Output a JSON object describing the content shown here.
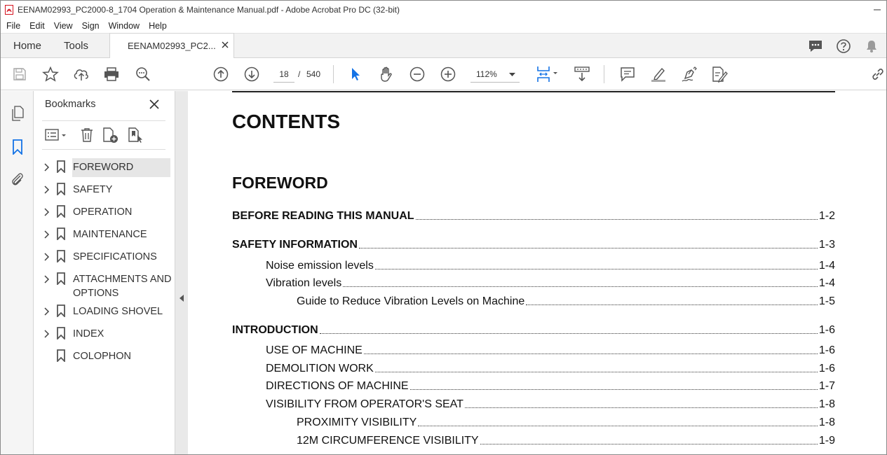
{
  "window": {
    "title": "EENAM02993_PC2000-8_1704 Operation & Maintenance Manual.pdf - Adobe Acrobat Pro DC (32-bit)"
  },
  "menu": [
    "File",
    "Edit",
    "View",
    "Sign",
    "Window",
    "Help"
  ],
  "tabs": {
    "home": "Home",
    "tools": "Tools",
    "document": "EENAM02993_PC2..."
  },
  "toolbar": {
    "current_page": "18",
    "page_separator": "/",
    "total_pages": "540",
    "zoom": "112%"
  },
  "bookmarks": {
    "title": "Bookmarks",
    "items": [
      {
        "label": "FOREWORD",
        "expandable": true,
        "selected": true
      },
      {
        "label": "SAFETY",
        "expandable": true
      },
      {
        "label": "OPERATION",
        "expandable": true
      },
      {
        "label": "MAINTENANCE",
        "expandable": true
      },
      {
        "label": "SPECIFICATIONS",
        "expandable": true
      },
      {
        "label": "ATTACHMENTS AND OPTIONS",
        "expandable": true
      },
      {
        "label": "LOADING SHOVEL",
        "expandable": true
      },
      {
        "label": "INDEX",
        "expandable": true
      },
      {
        "label": "COLOPHON",
        "expandable": false
      }
    ]
  },
  "document": {
    "heading": "CONTENTS",
    "section": "FOREWORD",
    "toc": [
      {
        "title": "BEFORE READING THIS MANUAL",
        "page": "1-2",
        "level": 0
      },
      {
        "title": "SAFETY INFORMATION",
        "page": "1-3",
        "level": 0
      },
      {
        "title": "Noise emission levels",
        "page": "1-4",
        "level": 1
      },
      {
        "title": "Vibration levels",
        "page": "1-4",
        "level": 1
      },
      {
        "title": "Guide to Reduce Vibration Levels on Machine",
        "page": "1-5",
        "level": 2
      },
      {
        "title": "INTRODUCTION",
        "page": "1-6",
        "level": 0
      },
      {
        "title": "USE OF MACHINE",
        "page": "1-6",
        "level": 1
      },
      {
        "title": "DEMOLITION WORK",
        "page": "1-6",
        "level": 1
      },
      {
        "title": "DIRECTIONS OF MACHINE",
        "page": "1-7",
        "level": 1
      },
      {
        "title": "VISIBILITY FROM OPERATOR'S SEAT",
        "page": "1-8",
        "level": 1
      },
      {
        "title": "PROXIMITY VISIBILITY",
        "page": "1-8",
        "level": 2
      },
      {
        "title": "12M CIRCUMFERENCE VISIBILITY",
        "page": "1-9",
        "level": 2
      }
    ]
  },
  "colors": {
    "accent_blue": "#1473e6",
    "icon_gray": "#555555",
    "acrobat_red": "#d4121e"
  }
}
